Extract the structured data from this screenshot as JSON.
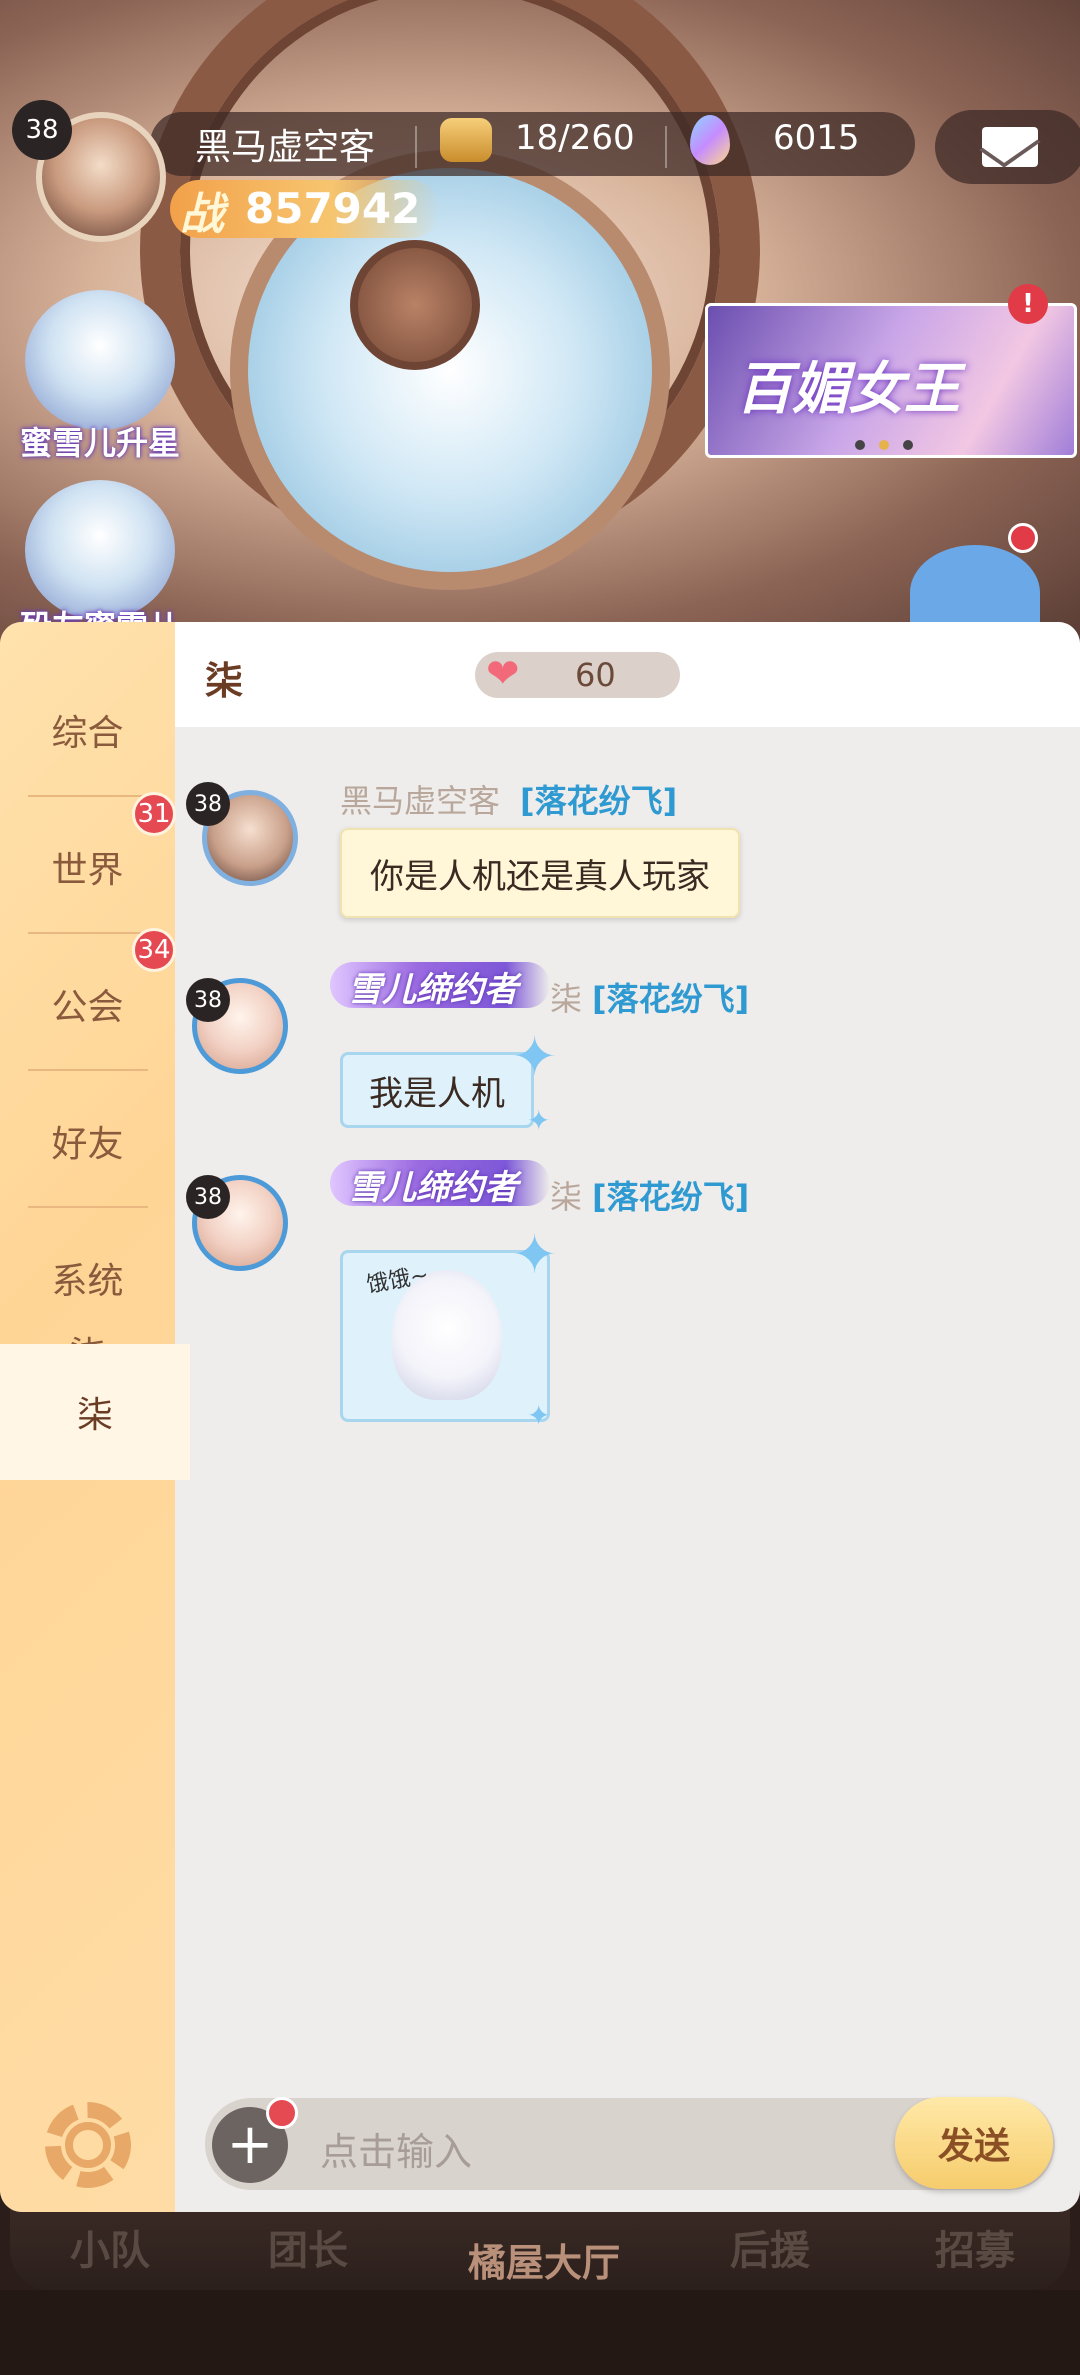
{
  "hud": {
    "level": "38",
    "player_name": "黑马虚空客",
    "stamina": "18/260",
    "gems": "6015",
    "power_label": "战",
    "power_value": "857942"
  },
  "events": [
    {
      "label": "蜜雪儿升星"
    },
    {
      "label": "殁友蜜雪儿"
    }
  ],
  "banner": {
    "text": "百媚女王",
    "alert": "!"
  },
  "chat": {
    "title": "柒",
    "affection": "60",
    "tabs": [
      {
        "label": "综合",
        "badge": ""
      },
      {
        "label": "世界",
        "badge": "31"
      },
      {
        "label": "公会",
        "badge": "34"
      },
      {
        "label": "好友",
        "badge": ""
      },
      {
        "label": "系统",
        "badge": ""
      },
      {
        "label": "柒",
        "badge": ""
      }
    ],
    "messages": [
      {
        "level": "38",
        "sender": "黑马虚空客",
        "guild": "[落花纷飞]",
        "text": "你是人机还是真人玩家"
      },
      {
        "level": "38",
        "title": "雪儿缔约者",
        "sender": "柒",
        "guild": "[落花纷飞]",
        "text": "我是人机"
      },
      {
        "level": "38",
        "title": "雪儿缔约者",
        "sender": "柒",
        "guild": "[落花纷飞]",
        "sticker_text": "饿饿~"
      }
    ],
    "input_placeholder": "点击输入",
    "send_label": "发送"
  },
  "bottom_nav": [
    "小队",
    "团长",
    "橘屋大厅",
    "后援",
    "招募"
  ]
}
